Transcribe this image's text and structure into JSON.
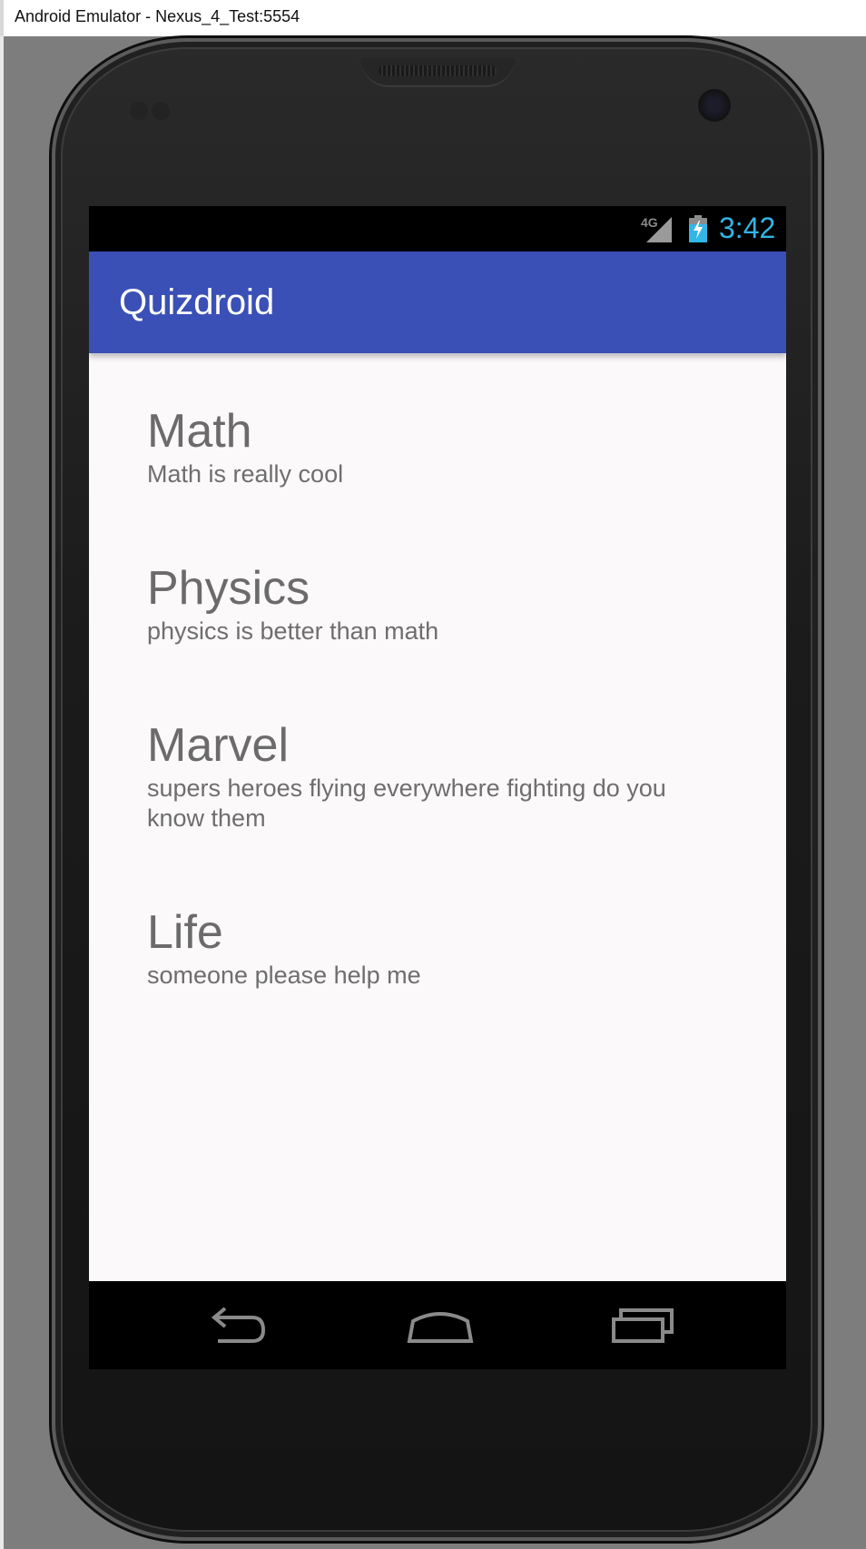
{
  "window": {
    "title": "Android Emulator - Nexus_4_Test:5554"
  },
  "status_bar": {
    "network": "4G",
    "time": "3:42",
    "clock_color": "#33b5e5"
  },
  "app_bar": {
    "title": "Quizdroid",
    "color": "#3a50b6"
  },
  "topics": [
    {
      "title": "Math",
      "description": "Math is really cool"
    },
    {
      "title": "Physics",
      "description": "physics is better than math"
    },
    {
      "title": "Marvel",
      "description": "supers heroes flying everywhere fighting do you know them"
    },
    {
      "title": "Life",
      "description": "someone please help me"
    }
  ],
  "nav_bar": {
    "icons": [
      "back-icon",
      "home-icon",
      "recents-icon"
    ]
  }
}
